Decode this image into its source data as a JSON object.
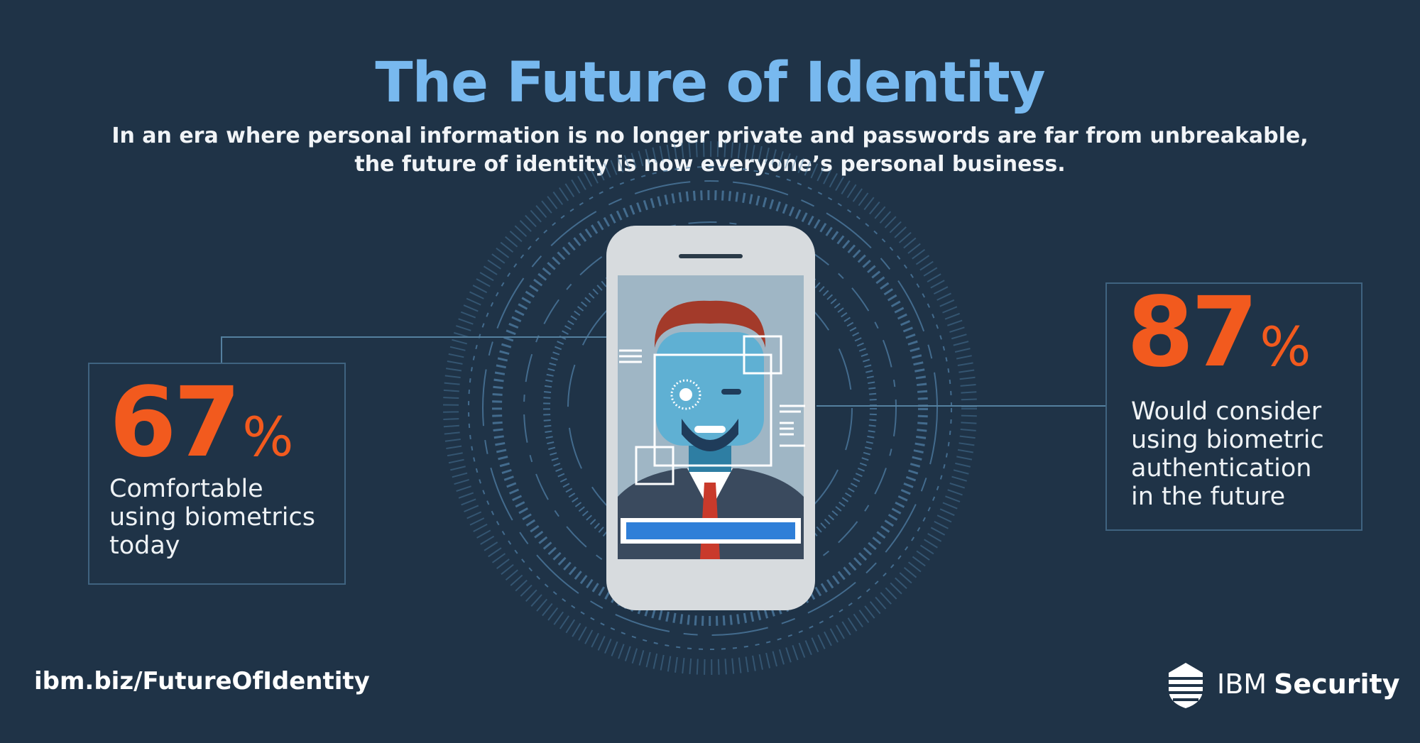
{
  "header": {
    "title": "The Future of Identity",
    "subtitle_line1": "In an era where personal information is no longer private and passwords are far from unbreakable,",
    "subtitle_line2": "the future of identity is now everyone’s personal business."
  },
  "stats": {
    "left": {
      "value": "67",
      "unit": "%",
      "label_lines": [
        "Comfortable",
        "using biometrics",
        "today"
      ]
    },
    "right": {
      "value": "87",
      "unit": "%",
      "label_lines": [
        "Would consider",
        "using biometric",
        "authentication",
        "in the future"
      ]
    }
  },
  "footer": {
    "url": "ibm.biz/FutureOfIdentity",
    "brand_prefix": "IBM",
    "brand_suffix": "Security",
    "brand_icon": "ibm-security-logo-icon"
  },
  "colors": {
    "background": "#1f3347",
    "title": "#78b9ef",
    "accent_orange": "#f25a1e",
    "box_border": "#3f6380"
  }
}
